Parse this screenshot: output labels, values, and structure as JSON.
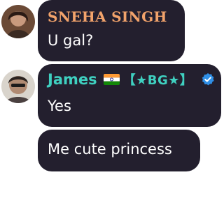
{
  "messages": [
    {
      "sender": "SNEHA SINGH",
      "text": "U gal?",
      "name_color": "#f2a36b"
    },
    {
      "sender": "James",
      "tag": "【★BG★】",
      "text": "Yes",
      "name_color": "#3fd0c0",
      "icons": [
        "india-flag-icon",
        "verified-badge-icon"
      ]
    },
    {
      "text": "Me cute princess"
    }
  ],
  "colors": {
    "bubble": "#231f2e",
    "message_text": "#ffffff",
    "verified": "#2f8fe6"
  }
}
